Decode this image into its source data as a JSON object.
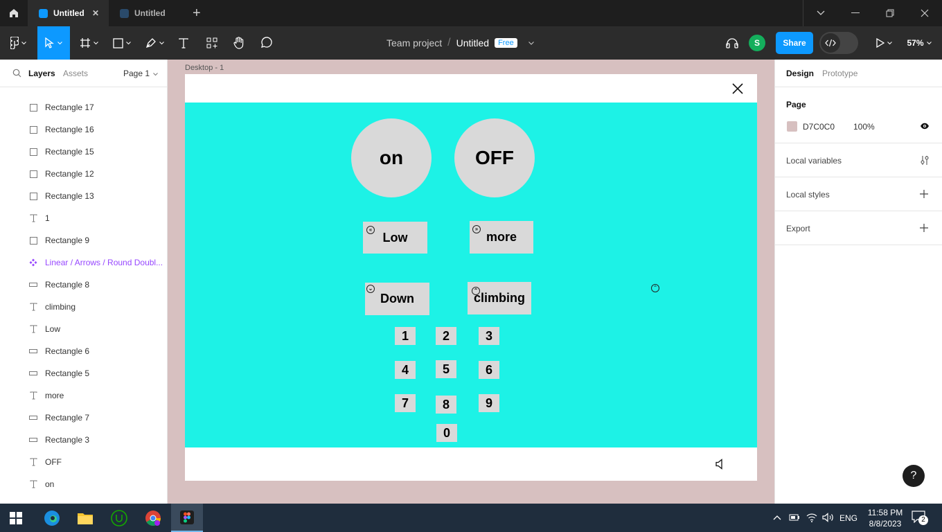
{
  "titlebar": {
    "tabs": [
      {
        "label": "Untitled",
        "active": true,
        "close": "✕"
      },
      {
        "label": "Untitled",
        "active": false
      }
    ],
    "new_tab": "+"
  },
  "toolbar": {
    "project": "Team project",
    "separator": "/",
    "file_name": "Untitled",
    "plan_badge": "Free",
    "avatar_letter": "S",
    "share_label": "Share",
    "zoom": "57%"
  },
  "left_panel": {
    "tabs": {
      "layers": "Layers",
      "assets": "Assets"
    },
    "page_selector": "Page 1",
    "layers": [
      {
        "name": "Rectangle 17",
        "icon": "rect"
      },
      {
        "name": "Rectangle 16",
        "icon": "rect"
      },
      {
        "name": "Rectangle 15",
        "icon": "rect"
      },
      {
        "name": "Rectangle 12",
        "icon": "rect"
      },
      {
        "name": "Rectangle 13",
        "icon": "rect"
      },
      {
        "name": "1",
        "icon": "text"
      },
      {
        "name": "Rectangle 9",
        "icon": "rect"
      },
      {
        "name": "Linear / Arrows / Round Doubl...",
        "icon": "component"
      },
      {
        "name": "Rectangle 8",
        "icon": "rect-wide"
      },
      {
        "name": "climbing",
        "icon": "text"
      },
      {
        "name": "Low",
        "icon": "text"
      },
      {
        "name": "Rectangle 6",
        "icon": "rect-wide"
      },
      {
        "name": "Rectangle 5",
        "icon": "rect-wide"
      },
      {
        "name": "more",
        "icon": "text"
      },
      {
        "name": "Rectangle 7",
        "icon": "rect-wide"
      },
      {
        "name": "Rectangle 3",
        "icon": "rect-wide"
      },
      {
        "name": "OFF",
        "icon": "text"
      },
      {
        "name": "on",
        "icon": "text"
      }
    ]
  },
  "canvas": {
    "frame_label": "Desktop - 1",
    "background_color": "#d7c0c0",
    "content_color": "#1df2e6",
    "buttons": {
      "on": "on",
      "off": "OFF",
      "low": "Low",
      "more": "more",
      "down": "Down",
      "climbing": "climbing"
    },
    "keys": [
      "1",
      "2",
      "3",
      "4",
      "5",
      "6",
      "7",
      "8",
      "9",
      "0"
    ]
  },
  "right_panel": {
    "tabs": {
      "design": "Design",
      "prototype": "Prototype"
    },
    "page_heading": "Page",
    "page_color": "D7C0C0",
    "page_opacity": "100%",
    "local_variables": "Local variables",
    "local_styles": "Local styles",
    "export": "Export",
    "help": "?"
  },
  "taskbar": {
    "language": "ENG",
    "time": "11:58 PM",
    "date": "8/8/2023",
    "notification_count": "2"
  }
}
